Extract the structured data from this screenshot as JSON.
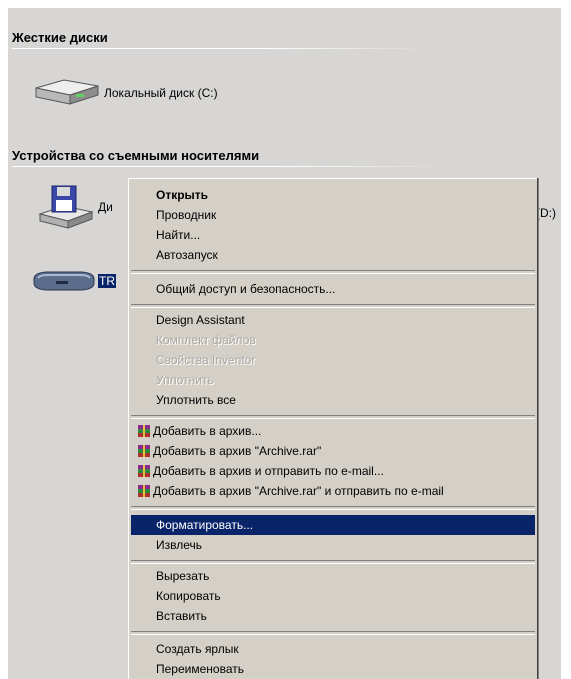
{
  "groups": {
    "hard_disks": {
      "title": "Жесткие диски"
    },
    "removable": {
      "title": "Устройства со съемными носителями"
    }
  },
  "drives": {
    "local_c": {
      "label": "Локальный диск (C:)",
      "icon": "hard-drive-icon"
    },
    "floppy": {
      "label_left": "Ди",
      "label_right": "(D:)",
      "icon": "floppy-drive-icon"
    },
    "removable_tr": {
      "label": "TR",
      "icon": "removable-drive-icon"
    }
  },
  "menu": {
    "open": "Открыть",
    "explorer": "Проводник",
    "find": "Найти...",
    "autoplay": "Автозапуск",
    "sharing": "Общий доступ и безопасность...",
    "design_assistant": "Design Assistant",
    "file_set": "Комплект файлов",
    "inventor_props": "Свойства Inventor",
    "compress": "Уплотнить",
    "compress_all": "Уплотнить все",
    "add_archive": "Добавить в архив...",
    "add_archive_rar": "Добавить в архив \"Archive.rar\"",
    "add_archive_email": "Добавить в архив и отправить по e-mail...",
    "add_archive_rar_email": "Добавить в архив \"Archive.rar\" и отправить по e-mail",
    "format": "Форматировать...",
    "eject": "Извлечь",
    "cut": "Вырезать",
    "copy": "Копировать",
    "paste": "Вставить",
    "create_shortcut": "Создать ярлык",
    "rename": "Переименовать"
  },
  "colors": {
    "highlight": "#0a246a",
    "menu_bg": "#d4d0c8",
    "window_bg": "#d7d6d4"
  }
}
